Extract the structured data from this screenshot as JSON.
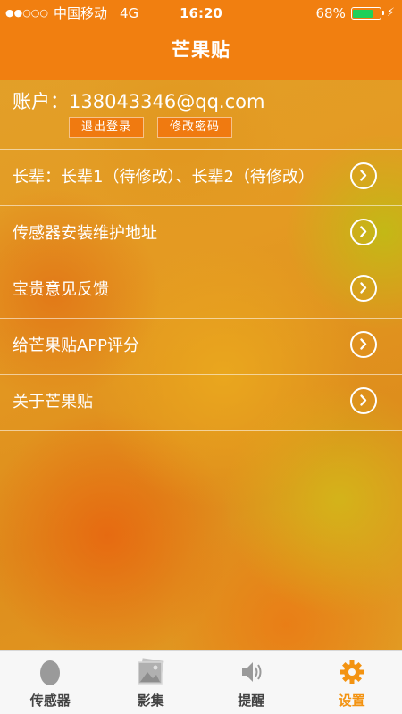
{
  "status_bar": {
    "signal": "●●○○○",
    "carrier": "中国移动",
    "network": "4G",
    "time": "16:20",
    "battery": "68%"
  },
  "header": {
    "title": "芒果贴"
  },
  "account": {
    "label": "账户：",
    "value": "138043346@qq.com",
    "logout_label": "退出登录",
    "change_password_label": "修改密码"
  },
  "menu": {
    "elders": "长辈：长辈1（待修改）、长辈2（待修改）",
    "sensor_address": "传感器安装维护地址",
    "feedback": "宝贵意见反馈",
    "rate_app": "给芒果贴APP评分",
    "about": "关于芒果贴"
  },
  "tabs": {
    "sensor": "传感器",
    "album": "影集",
    "reminder": "提醒",
    "settings": "设置"
  },
  "colors": {
    "header": "#f17f10",
    "active_tab": "#f39311",
    "inactive_icon": "#9a9a9a",
    "battery_fill": "#1fd05a"
  },
  "icons": [
    "chevron-right-circle-icon",
    "egg-icon",
    "photo-icon",
    "speaker-icon",
    "gear-icon",
    "battery-icon",
    "charging-bolt-icon"
  ]
}
